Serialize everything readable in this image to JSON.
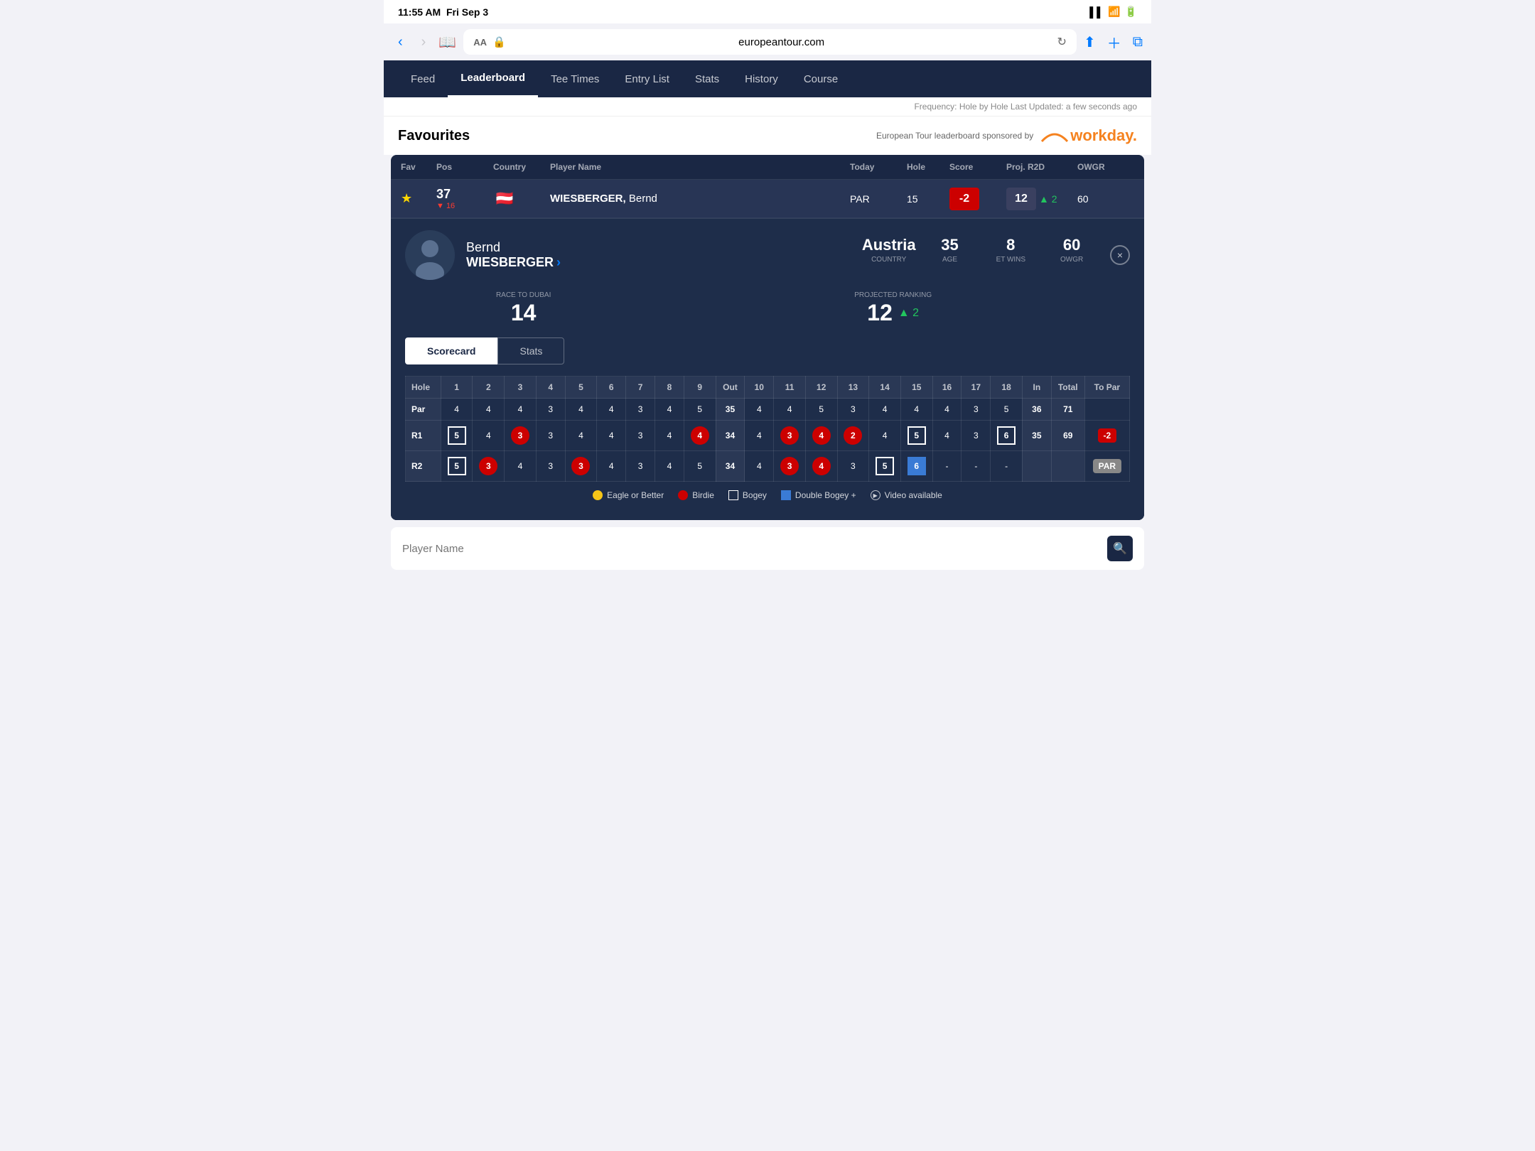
{
  "statusBar": {
    "time": "11:55 AM",
    "date": "Fri Sep 3"
  },
  "addressBar": {
    "fontSizeLabel": "AA",
    "url": "europeantour.com",
    "lockIcon": "🔒"
  },
  "nav": {
    "items": [
      {
        "label": "Feed",
        "active": false
      },
      {
        "label": "Leaderboard",
        "active": true
      },
      {
        "label": "Tee Times",
        "active": false
      },
      {
        "label": "Entry List",
        "active": false
      },
      {
        "label": "Stats",
        "active": false
      },
      {
        "label": "History",
        "active": false
      },
      {
        "label": "Course",
        "active": false
      }
    ]
  },
  "updateBar": {
    "text": "Frequency: Hole by Hole   Last Updated: a few seconds ago"
  },
  "favourites": {
    "title": "Favourites",
    "sponsorText": "European Tour leaderboard sponsored by",
    "sponsorName": "workday."
  },
  "leaderboard": {
    "headers": {
      "fav": "Fav",
      "pos": "Pos",
      "country": "Country",
      "playerName": "Player Name",
      "today": "Today",
      "hole": "Hole",
      "score": "Score",
      "projR2D": "Proj. R2D",
      "owgr": "OWGR"
    },
    "row": {
      "starred": true,
      "pos": "37",
      "posChange": "▼ 16",
      "countryFlag": "🇦🇹",
      "lastName": "WIESBERGER,",
      "firstName": "Bernd",
      "today": "PAR",
      "hole": "15",
      "score": "-2",
      "projR2D": "12",
      "projArrow": "▲ 2",
      "owgr": "60"
    }
  },
  "playerDetail": {
    "firstName": "Bernd",
    "lastName": "WIESBERGER",
    "linkArrow": "›",
    "country": "Austria",
    "countryLabel": "COUNTRY",
    "age": "35",
    "ageLabel": "AGE",
    "etWins": "8",
    "etWinsLabel": "ET WINS",
    "owgr": "60",
    "owgrLabel": "OWGR",
    "raceToDubai": "14",
    "raceToDubaiLabel": "RACE TO DUBAI",
    "projRanking": "12",
    "projRankingLabel": "PROJECTED RANKING",
    "projArrow": "▲ 2",
    "closeLabel": "×"
  },
  "tabs": {
    "scorecard": "Scorecard",
    "stats": "Stats"
  },
  "scorecard": {
    "holes": [
      "Hole",
      "1",
      "2",
      "3",
      "4",
      "5",
      "6",
      "7",
      "8",
      "9",
      "Out",
      "10",
      "11",
      "12",
      "13",
      "14",
      "15",
      "16",
      "17",
      "18",
      "In",
      "Total",
      "To Par"
    ],
    "par": [
      "Par",
      "4",
      "4",
      "4",
      "3",
      "4",
      "4",
      "3",
      "4",
      "5",
      "35",
      "4",
      "4",
      "5",
      "3",
      "4",
      "4",
      "4",
      "3",
      "5",
      "36",
      "71",
      ""
    ],
    "r1": {
      "label": "R1",
      "scores": [
        "5",
        "4",
        "3",
        "3",
        "4",
        "4",
        "3",
        "4",
        "4",
        "34",
        "4",
        "3",
        "4",
        "2",
        "4",
        "5",
        "4",
        "3",
        "6",
        "35",
        "69",
        "-2"
      ],
      "types": [
        "bogey",
        "par",
        "birdie",
        "par",
        "par",
        "par",
        "par",
        "par",
        "birdie",
        "out",
        "par",
        "birdie",
        "par",
        "birdie",
        "par",
        "bogey",
        "par",
        "par",
        "bogey",
        "in",
        "total",
        "score-neg"
      ]
    },
    "r2": {
      "label": "R2",
      "scores": [
        "5",
        "3",
        "4",
        "3",
        "3",
        "4",
        "3",
        "4",
        "5",
        "34",
        "4",
        "3",
        "4",
        "3",
        "5",
        "6",
        "-",
        "-",
        "-",
        "",
        "",
        "PAR"
      ],
      "types": [
        "bogey",
        "birdie",
        "par",
        "par",
        "birdie",
        "par",
        "par",
        "par",
        "par",
        "out",
        "par",
        "birdie",
        "par",
        "par",
        "bogey",
        "double",
        "dash",
        "dash",
        "dash",
        "in",
        "total",
        "score-par"
      ]
    }
  },
  "legend": [
    {
      "type": "dot-yellow",
      "label": "Eagle or Better"
    },
    {
      "type": "dot-red",
      "label": "Birdie"
    },
    {
      "type": "square-white",
      "label": "Bogey"
    },
    {
      "type": "square-blue",
      "label": "Double Bogey +"
    },
    {
      "type": "circle-play",
      "label": "Video available"
    }
  ],
  "playerSearch": {
    "placeholder": "Player Name",
    "searchIcon": "🔍"
  }
}
